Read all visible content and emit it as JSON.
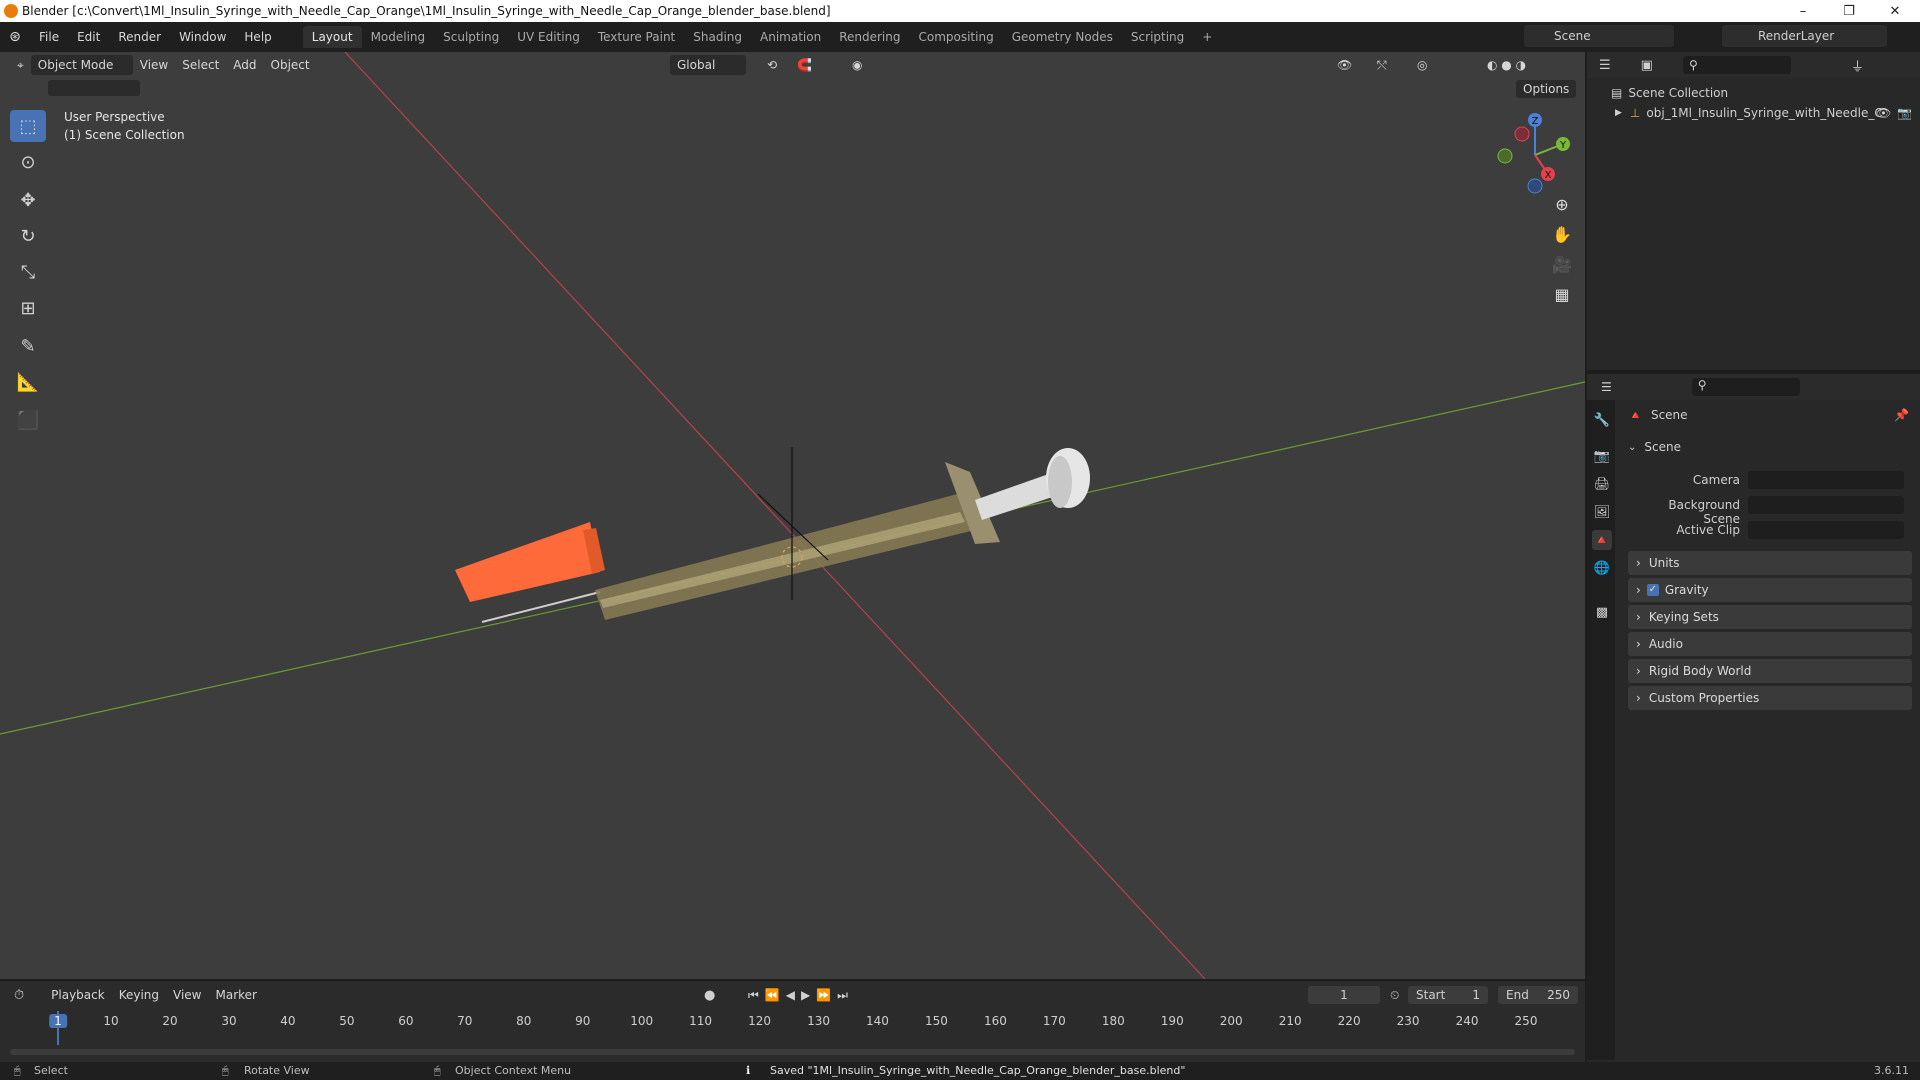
{
  "window": {
    "title": "Blender [c:\\Convert\\1Ml_Insulin_Syringe_with_Needle_Cap_Orange\\1Ml_Insulin_Syringe_with_Needle_Cap_Orange_blender_base.blend]",
    "minimize": "–",
    "maximize": "❐",
    "close": "✕"
  },
  "menu": [
    "File",
    "Edit",
    "Render",
    "Window",
    "Help"
  ],
  "workspaces": {
    "tabs": [
      "Layout",
      "Modeling",
      "Sculpting",
      "UV Editing",
      "Texture Paint",
      "Shading",
      "Animation",
      "Rendering",
      "Compositing",
      "Geometry Nodes",
      "Scripting"
    ],
    "add": "+",
    "active": "Layout"
  },
  "scene_selector": {
    "label": "Scene",
    "render_layer": "RenderLayer"
  },
  "viewport_header": {
    "mode": "Object Mode",
    "menus": [
      "View",
      "Select",
      "Add",
      "Object"
    ],
    "transform": "Global",
    "options": "Options"
  },
  "viewport": {
    "perspective": "User Perspective",
    "collection": "(1) Scene Collection",
    "gizmo": {
      "z": "Z",
      "y": "Y",
      "x": "X"
    }
  },
  "outliner": {
    "root": "Scene Collection",
    "object": "obj_1Ml_Insulin_Syringe_with_Needle_C"
  },
  "properties": {
    "header": "Scene",
    "section": "Scene",
    "fields": [
      {
        "label": "Camera"
      },
      {
        "label": "Background Scene"
      },
      {
        "label": "Active Clip"
      }
    ],
    "panels": [
      "Units",
      "Gravity",
      "Keying Sets",
      "Audio",
      "Rigid Body World",
      "Custom Properties"
    ]
  },
  "timeline": {
    "menus": [
      "Playback",
      "Keying",
      "View",
      "Marker"
    ],
    "current_frame": "1",
    "start_label": "Start",
    "start": "1",
    "end_label": "End",
    "end": "250",
    "ticks": [
      "1",
      "10",
      "20",
      "30",
      "40",
      "50",
      "60",
      "70",
      "80",
      "90",
      "100",
      "110",
      "120",
      "130",
      "140",
      "150",
      "160",
      "170",
      "180",
      "190",
      "200",
      "210",
      "220",
      "230",
      "240",
      "250"
    ]
  },
  "status": {
    "select": "Select",
    "rotate": "Rotate View",
    "context": "Object Context Menu",
    "message": "Saved \"1Ml_Insulin_Syringe_with_Needle_Cap_Orange_blender_base.blend\"",
    "version": "3.6.11"
  }
}
